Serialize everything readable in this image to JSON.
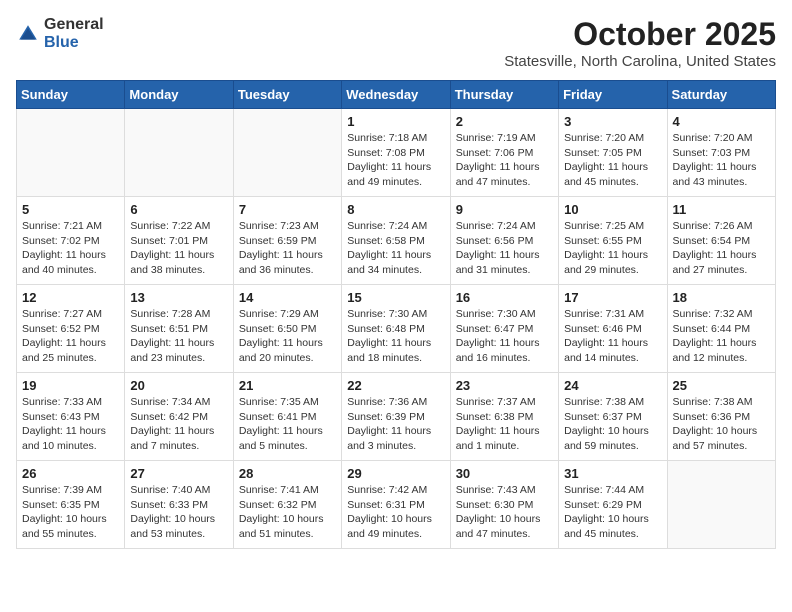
{
  "logo": {
    "general": "General",
    "blue": "Blue"
  },
  "title": "October 2025",
  "subtitle": "Statesville, North Carolina, United States",
  "days_of_week": [
    "Sunday",
    "Monday",
    "Tuesday",
    "Wednesday",
    "Thursday",
    "Friday",
    "Saturday"
  ],
  "weeks": [
    [
      {
        "day": "",
        "info": ""
      },
      {
        "day": "",
        "info": ""
      },
      {
        "day": "",
        "info": ""
      },
      {
        "day": "1",
        "info": "Sunrise: 7:18 AM\nSunset: 7:08 PM\nDaylight: 11 hours and 49 minutes."
      },
      {
        "day": "2",
        "info": "Sunrise: 7:19 AM\nSunset: 7:06 PM\nDaylight: 11 hours and 47 minutes."
      },
      {
        "day": "3",
        "info": "Sunrise: 7:20 AM\nSunset: 7:05 PM\nDaylight: 11 hours and 45 minutes."
      },
      {
        "day": "4",
        "info": "Sunrise: 7:20 AM\nSunset: 7:03 PM\nDaylight: 11 hours and 43 minutes."
      }
    ],
    [
      {
        "day": "5",
        "info": "Sunrise: 7:21 AM\nSunset: 7:02 PM\nDaylight: 11 hours and 40 minutes."
      },
      {
        "day": "6",
        "info": "Sunrise: 7:22 AM\nSunset: 7:01 PM\nDaylight: 11 hours and 38 minutes."
      },
      {
        "day": "7",
        "info": "Sunrise: 7:23 AM\nSunset: 6:59 PM\nDaylight: 11 hours and 36 minutes."
      },
      {
        "day": "8",
        "info": "Sunrise: 7:24 AM\nSunset: 6:58 PM\nDaylight: 11 hours and 34 minutes."
      },
      {
        "day": "9",
        "info": "Sunrise: 7:24 AM\nSunset: 6:56 PM\nDaylight: 11 hours and 31 minutes."
      },
      {
        "day": "10",
        "info": "Sunrise: 7:25 AM\nSunset: 6:55 PM\nDaylight: 11 hours and 29 minutes."
      },
      {
        "day": "11",
        "info": "Sunrise: 7:26 AM\nSunset: 6:54 PM\nDaylight: 11 hours and 27 minutes."
      }
    ],
    [
      {
        "day": "12",
        "info": "Sunrise: 7:27 AM\nSunset: 6:52 PM\nDaylight: 11 hours and 25 minutes."
      },
      {
        "day": "13",
        "info": "Sunrise: 7:28 AM\nSunset: 6:51 PM\nDaylight: 11 hours and 23 minutes."
      },
      {
        "day": "14",
        "info": "Sunrise: 7:29 AM\nSunset: 6:50 PM\nDaylight: 11 hours and 20 minutes."
      },
      {
        "day": "15",
        "info": "Sunrise: 7:30 AM\nSunset: 6:48 PM\nDaylight: 11 hours and 18 minutes."
      },
      {
        "day": "16",
        "info": "Sunrise: 7:30 AM\nSunset: 6:47 PM\nDaylight: 11 hours and 16 minutes."
      },
      {
        "day": "17",
        "info": "Sunrise: 7:31 AM\nSunset: 6:46 PM\nDaylight: 11 hours and 14 minutes."
      },
      {
        "day": "18",
        "info": "Sunrise: 7:32 AM\nSunset: 6:44 PM\nDaylight: 11 hours and 12 minutes."
      }
    ],
    [
      {
        "day": "19",
        "info": "Sunrise: 7:33 AM\nSunset: 6:43 PM\nDaylight: 11 hours and 10 minutes."
      },
      {
        "day": "20",
        "info": "Sunrise: 7:34 AM\nSunset: 6:42 PM\nDaylight: 11 hours and 7 minutes."
      },
      {
        "day": "21",
        "info": "Sunrise: 7:35 AM\nSunset: 6:41 PM\nDaylight: 11 hours and 5 minutes."
      },
      {
        "day": "22",
        "info": "Sunrise: 7:36 AM\nSunset: 6:39 PM\nDaylight: 11 hours and 3 minutes."
      },
      {
        "day": "23",
        "info": "Sunrise: 7:37 AM\nSunset: 6:38 PM\nDaylight: 11 hours and 1 minute."
      },
      {
        "day": "24",
        "info": "Sunrise: 7:38 AM\nSunset: 6:37 PM\nDaylight: 10 hours and 59 minutes."
      },
      {
        "day": "25",
        "info": "Sunrise: 7:38 AM\nSunset: 6:36 PM\nDaylight: 10 hours and 57 minutes."
      }
    ],
    [
      {
        "day": "26",
        "info": "Sunrise: 7:39 AM\nSunset: 6:35 PM\nDaylight: 10 hours and 55 minutes."
      },
      {
        "day": "27",
        "info": "Sunrise: 7:40 AM\nSunset: 6:33 PM\nDaylight: 10 hours and 53 minutes."
      },
      {
        "day": "28",
        "info": "Sunrise: 7:41 AM\nSunset: 6:32 PM\nDaylight: 10 hours and 51 minutes."
      },
      {
        "day": "29",
        "info": "Sunrise: 7:42 AM\nSunset: 6:31 PM\nDaylight: 10 hours and 49 minutes."
      },
      {
        "day": "30",
        "info": "Sunrise: 7:43 AM\nSunset: 6:30 PM\nDaylight: 10 hours and 47 minutes."
      },
      {
        "day": "31",
        "info": "Sunrise: 7:44 AM\nSunset: 6:29 PM\nDaylight: 10 hours and 45 minutes."
      },
      {
        "day": "",
        "info": ""
      }
    ]
  ]
}
